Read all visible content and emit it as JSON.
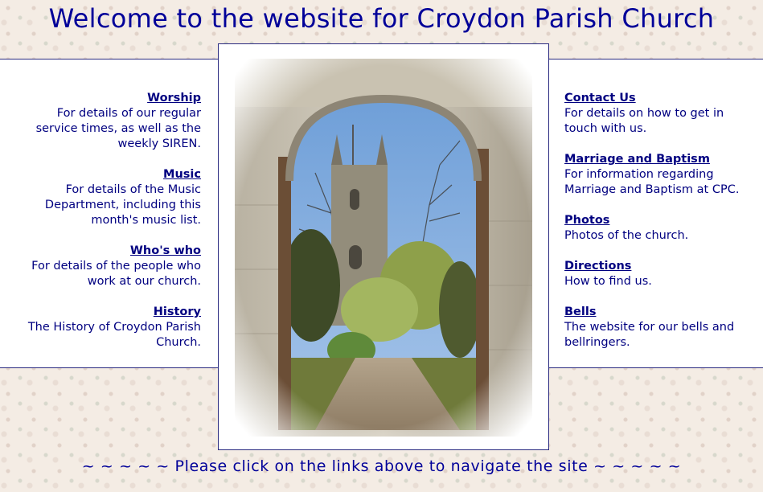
{
  "page": {
    "title": "Welcome to the website for Croydon Parish Church",
    "footer": "~ ~ ~ ~ ~ Please click on the links above to navigate the site ~ ~ ~ ~ ~"
  },
  "nav_left": [
    {
      "label": "Worship",
      "description": "For details of our regular service times, as well as the weekly SIREN."
    },
    {
      "label": "Music",
      "description": "For details of the Music Department, including this month's music list."
    },
    {
      "label": "Who's who",
      "description": "For details of the people who work at our church."
    },
    {
      "label": "History",
      "description": "The History of Croydon Parish Church."
    }
  ],
  "nav_right": [
    {
      "label": "Contact Us",
      "description": "For details on how to get in touch with us."
    },
    {
      "label": "Marriage and Baptism",
      "description": "For information regarding Marriage and Baptism at CPC."
    },
    {
      "label": "Photos",
      "description": "Photos of the church."
    },
    {
      "label": "Directions",
      "description": "How to find us."
    },
    {
      "label": "Bells",
      "description": "The website for our bells and bellringers."
    }
  ],
  "colors": {
    "text": "#000080",
    "title": "#000099",
    "band_background": "#ffffff",
    "page_background": "#f4ece4"
  }
}
